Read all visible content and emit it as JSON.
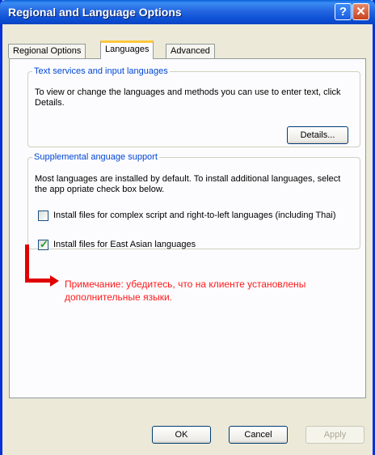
{
  "window": {
    "title": "Regional and Language Options"
  },
  "titlebar": {
    "help_glyph": "?",
    "close_glyph": "✕"
  },
  "tabs": [
    {
      "label": "Regional Options",
      "active": false
    },
    {
      "label": "Languages",
      "active": true
    },
    {
      "label": "Advanced",
      "active": false
    }
  ],
  "text_services": {
    "legend": "Text services and input languages",
    "description": "To view or change the languages and methods you can use to enter text, click Details.",
    "details_button": "Details..."
  },
  "supplemental": {
    "legend": "Supplemental anguage support",
    "description": "Most languages are installed by default. To install additional languages, select the app opriate check box below.",
    "checkboxes": [
      {
        "label": "Install files for complex script and right-to-left languages (including Thai)",
        "checked": false
      },
      {
        "label": "Install files for East Asian languages",
        "checked": true
      }
    ]
  },
  "annotation": {
    "note": "Примечание: убедитесь, что на клиенте установлены дополнительные языки.",
    "color": "#e00000"
  },
  "footer": {
    "ok_label": "OK",
    "cancel_label": "Cancel",
    "apply_label": "Apply"
  },
  "colors": {
    "legend": "#0046d5",
    "titlebar": "#0a4fd4",
    "check": "#21a121"
  }
}
